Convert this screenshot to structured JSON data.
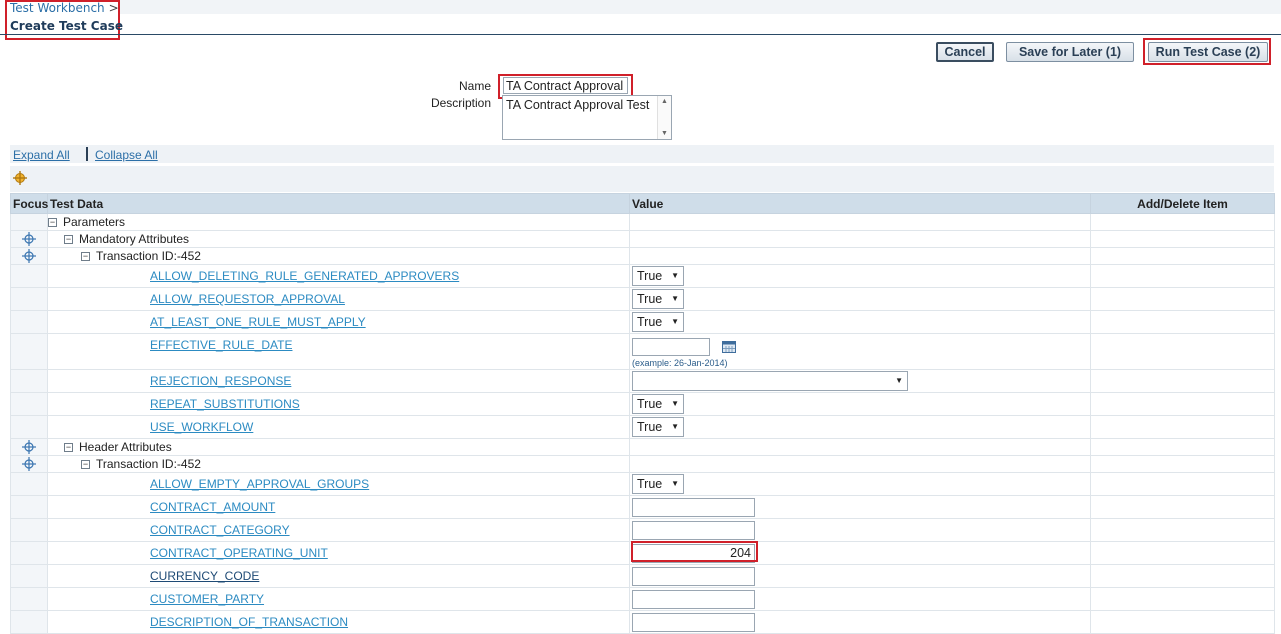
{
  "breadcrumb": {
    "parent": "Test Workbench",
    "separator": ">"
  },
  "page_title": "Create Test Case",
  "buttons": {
    "cancel": "Cancel",
    "save_later": "Save for Later (1)",
    "run": "Run Test Case (2)"
  },
  "form": {
    "name_label": "Name",
    "name_value": "TA Contract Approval",
    "description_label": "Description",
    "description_value": "TA Contract Approval Test"
  },
  "tree_controls": {
    "expand_all": "Expand All",
    "collapse_all": "Collapse All"
  },
  "table": {
    "headers": {
      "focus": "Focus",
      "test_data": "Test Data",
      "value": "Value",
      "add_delete": "Add/Delete Item"
    },
    "parameters": "Parameters",
    "mandatory_attributes": "Mandatory Attributes",
    "header_attributes": "Header Attributes",
    "transaction_id_1": "Transaction ID:-452",
    "transaction_id_2": "Transaction ID:-452",
    "mandatory_rows": [
      {
        "name": "ALLOW_DELETING_RULE_GENERATED_APPROVERS",
        "value": "True"
      },
      {
        "name": "ALLOW_REQUESTOR_APPROVAL",
        "value": "True"
      },
      {
        "name": "AT_LEAST_ONE_RULE_MUST_APPLY",
        "value": "True"
      },
      {
        "name": "EFFECTIVE_RULE_DATE",
        "value": "",
        "hint": "(example: 26-Jan-2014)"
      },
      {
        "name": "REJECTION_RESPONSE",
        "value": ""
      },
      {
        "name": "REPEAT_SUBSTITUTIONS",
        "value": "True"
      },
      {
        "name": "USE_WORKFLOW",
        "value": "True"
      }
    ],
    "header_rows": [
      {
        "name": "ALLOW_EMPTY_APPROVAL_GROUPS",
        "value": "True"
      },
      {
        "name": "CONTRACT_AMOUNT",
        "value": ""
      },
      {
        "name": "CONTRACT_CATEGORY",
        "value": ""
      },
      {
        "name": "CONTRACT_OPERATING_UNIT",
        "value": "204"
      },
      {
        "name": "CURRENCY_CODE",
        "value": ""
      },
      {
        "name": "CUSTOMER_PARTY",
        "value": ""
      },
      {
        "name": "DESCRIPTION_OF_TRANSACTION",
        "value": ""
      }
    ]
  },
  "colors": {
    "link": "#2c8bc2",
    "header_bg": "#cfdde9",
    "highlight": "#d0202a",
    "title": "#1f3b5a"
  }
}
